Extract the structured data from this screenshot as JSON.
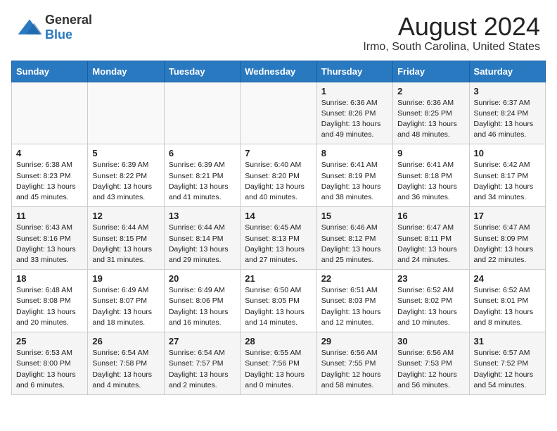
{
  "header": {
    "logo_general": "General",
    "logo_blue": "Blue",
    "title": "August 2024",
    "subtitle": "Irmo, South Carolina, United States"
  },
  "days_of_week": [
    "Sunday",
    "Monday",
    "Tuesday",
    "Wednesday",
    "Thursday",
    "Friday",
    "Saturday"
  ],
  "weeks": [
    [
      {
        "day": "",
        "info": ""
      },
      {
        "day": "",
        "info": ""
      },
      {
        "day": "",
        "info": ""
      },
      {
        "day": "",
        "info": ""
      },
      {
        "day": "1",
        "info": "Sunrise: 6:36 AM\nSunset: 8:26 PM\nDaylight: 13 hours\nand 49 minutes."
      },
      {
        "day": "2",
        "info": "Sunrise: 6:36 AM\nSunset: 8:25 PM\nDaylight: 13 hours\nand 48 minutes."
      },
      {
        "day": "3",
        "info": "Sunrise: 6:37 AM\nSunset: 8:24 PM\nDaylight: 13 hours\nand 46 minutes."
      }
    ],
    [
      {
        "day": "4",
        "info": "Sunrise: 6:38 AM\nSunset: 8:23 PM\nDaylight: 13 hours\nand 45 minutes."
      },
      {
        "day": "5",
        "info": "Sunrise: 6:39 AM\nSunset: 8:22 PM\nDaylight: 13 hours\nand 43 minutes."
      },
      {
        "day": "6",
        "info": "Sunrise: 6:39 AM\nSunset: 8:21 PM\nDaylight: 13 hours\nand 41 minutes."
      },
      {
        "day": "7",
        "info": "Sunrise: 6:40 AM\nSunset: 8:20 PM\nDaylight: 13 hours\nand 40 minutes."
      },
      {
        "day": "8",
        "info": "Sunrise: 6:41 AM\nSunset: 8:19 PM\nDaylight: 13 hours\nand 38 minutes."
      },
      {
        "day": "9",
        "info": "Sunrise: 6:41 AM\nSunset: 8:18 PM\nDaylight: 13 hours\nand 36 minutes."
      },
      {
        "day": "10",
        "info": "Sunrise: 6:42 AM\nSunset: 8:17 PM\nDaylight: 13 hours\nand 34 minutes."
      }
    ],
    [
      {
        "day": "11",
        "info": "Sunrise: 6:43 AM\nSunset: 8:16 PM\nDaylight: 13 hours\nand 33 minutes."
      },
      {
        "day": "12",
        "info": "Sunrise: 6:44 AM\nSunset: 8:15 PM\nDaylight: 13 hours\nand 31 minutes."
      },
      {
        "day": "13",
        "info": "Sunrise: 6:44 AM\nSunset: 8:14 PM\nDaylight: 13 hours\nand 29 minutes."
      },
      {
        "day": "14",
        "info": "Sunrise: 6:45 AM\nSunset: 8:13 PM\nDaylight: 13 hours\nand 27 minutes."
      },
      {
        "day": "15",
        "info": "Sunrise: 6:46 AM\nSunset: 8:12 PM\nDaylight: 13 hours\nand 25 minutes."
      },
      {
        "day": "16",
        "info": "Sunrise: 6:47 AM\nSunset: 8:11 PM\nDaylight: 13 hours\nand 24 minutes."
      },
      {
        "day": "17",
        "info": "Sunrise: 6:47 AM\nSunset: 8:09 PM\nDaylight: 13 hours\nand 22 minutes."
      }
    ],
    [
      {
        "day": "18",
        "info": "Sunrise: 6:48 AM\nSunset: 8:08 PM\nDaylight: 13 hours\nand 20 minutes."
      },
      {
        "day": "19",
        "info": "Sunrise: 6:49 AM\nSunset: 8:07 PM\nDaylight: 13 hours\nand 18 minutes."
      },
      {
        "day": "20",
        "info": "Sunrise: 6:49 AM\nSunset: 8:06 PM\nDaylight: 13 hours\nand 16 minutes."
      },
      {
        "day": "21",
        "info": "Sunrise: 6:50 AM\nSunset: 8:05 PM\nDaylight: 13 hours\nand 14 minutes."
      },
      {
        "day": "22",
        "info": "Sunrise: 6:51 AM\nSunset: 8:03 PM\nDaylight: 13 hours\nand 12 minutes."
      },
      {
        "day": "23",
        "info": "Sunrise: 6:52 AM\nSunset: 8:02 PM\nDaylight: 13 hours\nand 10 minutes."
      },
      {
        "day": "24",
        "info": "Sunrise: 6:52 AM\nSunset: 8:01 PM\nDaylight: 13 hours\nand 8 minutes."
      }
    ],
    [
      {
        "day": "25",
        "info": "Sunrise: 6:53 AM\nSunset: 8:00 PM\nDaylight: 13 hours\nand 6 minutes."
      },
      {
        "day": "26",
        "info": "Sunrise: 6:54 AM\nSunset: 7:58 PM\nDaylight: 13 hours\nand 4 minutes."
      },
      {
        "day": "27",
        "info": "Sunrise: 6:54 AM\nSunset: 7:57 PM\nDaylight: 13 hours\nand 2 minutes."
      },
      {
        "day": "28",
        "info": "Sunrise: 6:55 AM\nSunset: 7:56 PM\nDaylight: 13 hours\nand 0 minutes."
      },
      {
        "day": "29",
        "info": "Sunrise: 6:56 AM\nSunset: 7:55 PM\nDaylight: 12 hours\nand 58 minutes."
      },
      {
        "day": "30",
        "info": "Sunrise: 6:56 AM\nSunset: 7:53 PM\nDaylight: 12 hours\nand 56 minutes."
      },
      {
        "day": "31",
        "info": "Sunrise: 6:57 AM\nSunset: 7:52 PM\nDaylight: 12 hours\nand 54 minutes."
      }
    ]
  ]
}
